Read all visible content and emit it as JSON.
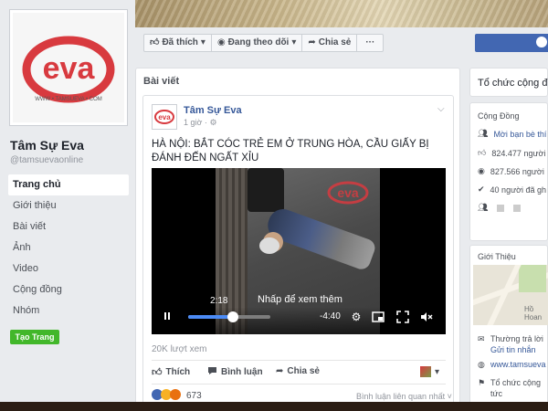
{
  "page": {
    "name": "Tâm Sự Eva",
    "handle": "@tamsuevaonline",
    "logo_text": "eva",
    "logo_sub": "WWW • TAMSUEVA • COM"
  },
  "nav": {
    "items": [
      {
        "label": "Trang chủ",
        "active": true
      },
      {
        "label": "Giới thiệu"
      },
      {
        "label": "Bài viết"
      },
      {
        "label": "Ảnh"
      },
      {
        "label": "Video"
      },
      {
        "label": "Cộng đồng"
      },
      {
        "label": "Nhóm"
      }
    ],
    "create_page": "Tạo Trang"
  },
  "actions": {
    "liked": "Đã thích",
    "following": "Đang theo dõi",
    "share": "Chia sẻ",
    "more": "···"
  },
  "feed": {
    "title": "Bài viết"
  },
  "post": {
    "author": "Tâm Sự Eva",
    "time": "1 giờ ·",
    "text": "HÀ NỘI: BẮT CÓC TRẺ EM Ở TRUNG HÒA, CẦU GIẤY BỊ ĐÁNH ĐẾN NGẤT XỈU",
    "video": {
      "watermark": "eva",
      "current_time": "2:18",
      "hint": "Nhấp để xem thêm",
      "remaining": "-4:40",
      "progress": 0.54
    },
    "views": "20K lượt xem",
    "like": "Thích",
    "comment": "Bình luận",
    "share": "Chia sẻ",
    "reaction_count": "673",
    "related": "Bình luận liên quan nhất ˅"
  },
  "sidebar_right": {
    "org_title": "Tổ chức cộng đồ",
    "community_title": "Cộng Đồng",
    "rows": [
      {
        "icon": "invite-icon",
        "text": "Mời bạn bè thí",
        "link": true
      },
      {
        "icon": "likes-icon",
        "text": "824.477 người"
      },
      {
        "icon": "follow-icon",
        "text": "827.566 người"
      },
      {
        "icon": "check-icon",
        "text": "40 người đã gh"
      }
    ],
    "intro_title": "Giới Thiệu",
    "map_label": "Hồ Hoan",
    "intro_rows": [
      {
        "icon": "chat-icon",
        "text": "Thường trả lời",
        "sub": "Gửi tin nhắn"
      },
      {
        "icon": "globe-icon",
        "text": "www.tamsueva"
      },
      {
        "icon": "flag-icon",
        "text": "Tổ chức cộng",
        "sub": "tức"
      }
    ]
  },
  "colors": {
    "brand": "#d83a3f",
    "link": "#365899",
    "fb_blue": "#4267b2",
    "green": "#42b72a"
  }
}
